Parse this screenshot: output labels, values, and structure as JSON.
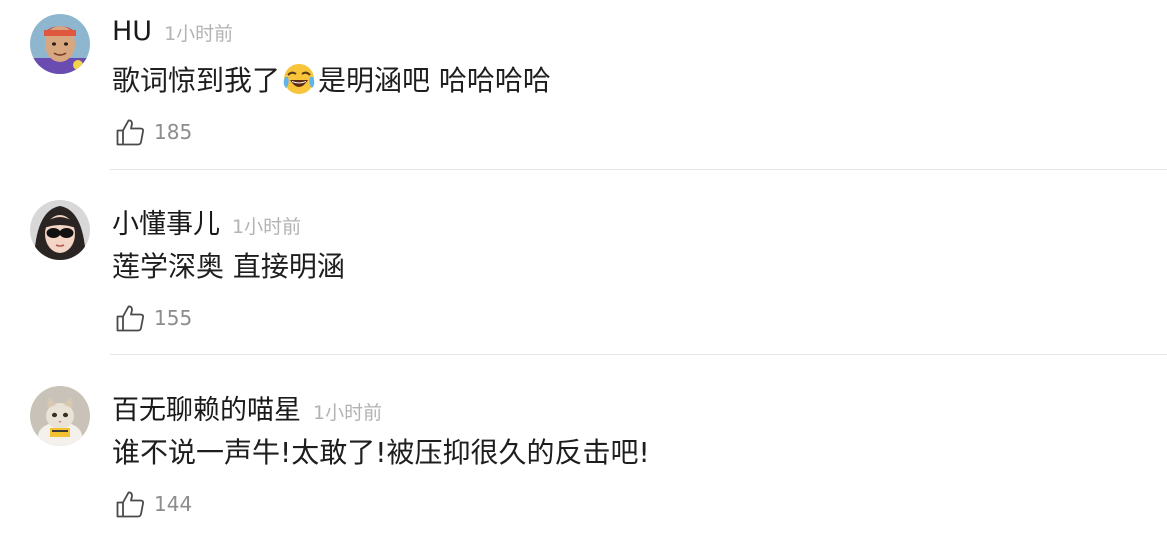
{
  "comments": [
    {
      "username": "HU",
      "time": "1小时前",
      "text_before": "歌词惊到我了",
      "emoji_name": "laughing-tears-emoji",
      "text_after": "是明涵吧 哈哈哈哈",
      "likes": "185",
      "avatar_icon": "avatar-hu"
    },
    {
      "username": "小懂事儿",
      "time": "1小时前",
      "text": "莲学深奥  直接明涵",
      "likes": "155",
      "avatar_icon": "avatar-sunglasses"
    },
    {
      "username": "百无聊赖的喵星",
      "time": "1小时前",
      "text": "谁不说一声牛!太敢了!被压抑很久的反击吧!",
      "likes": "144",
      "avatar_icon": "avatar-cat"
    }
  ],
  "colors": {
    "username": "#1a1a1a",
    "timestamp": "#b3b3b3",
    "text": "#1e1e1e",
    "like": "#8c8c8c",
    "divider": "#e6e6e6"
  }
}
